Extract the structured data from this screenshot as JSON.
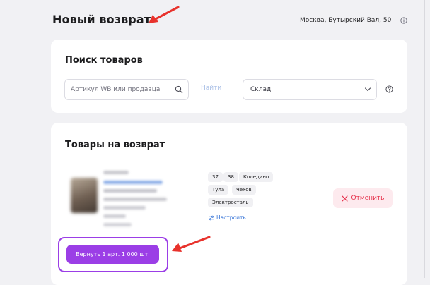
{
  "header": {
    "title": "Новый возврат",
    "location": "Москва, Бутырский Вал, 50"
  },
  "search": {
    "title": "Поиск товаров",
    "input_placeholder": "Артикул WB или продавца",
    "input_value": "",
    "find_label": "Найти",
    "warehouse_select": "Склад"
  },
  "goods": {
    "title": "Товары на возврат",
    "tags": [
      "37",
      "38",
      "Коледино",
      "Тула",
      "Чехов",
      "Электросталь"
    ],
    "configure_label": "Настроить",
    "cancel_label": "Отменить",
    "return_button": "Вернуть 1 арт. 1 000 шт."
  },
  "icons": {
    "location_info": "info-icon",
    "search": "search-icon",
    "select": "chevron-down-icon",
    "help": "question-circle-icon",
    "configure": "sliders-icon",
    "cancel": "close-icon"
  },
  "colors": {
    "accent": "#9b3ee6",
    "link": "#2f6fd6",
    "danger": "#e6304a",
    "danger_bg": "#fdeaee",
    "annotation_red": "#e8322c"
  }
}
